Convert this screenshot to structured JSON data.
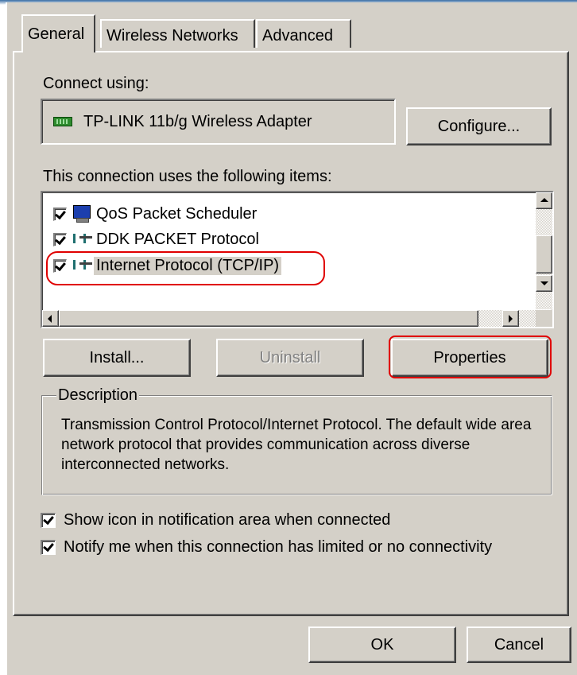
{
  "tabs": [
    {
      "label": "General",
      "active": true
    },
    {
      "label": "Wireless Networks",
      "active": false
    },
    {
      "label": "Advanced",
      "active": false
    }
  ],
  "connect_using": {
    "label": "Connect using:",
    "adapter_name": "TP-LINK 11b/g Wireless Adapter",
    "adapter_icon": "network-card-icon",
    "configure_label": "Configure..."
  },
  "items_section": {
    "label": "This connection uses the following items:",
    "items": [
      {
        "label": "QoS Packet Scheduler",
        "checked": true,
        "icon": "monitor-icon"
      },
      {
        "label": "DDK PACKET Protocol",
        "checked": true,
        "icon": "network-protocol-icon"
      },
      {
        "label": "Internet Protocol (TCP/IP)",
        "checked": true,
        "icon": "network-protocol-icon",
        "selected": true
      }
    ]
  },
  "buttons": {
    "install": "Install...",
    "uninstall": "Uninstall",
    "properties": "Properties",
    "ok": "OK",
    "cancel": "Cancel"
  },
  "description": {
    "title": "Description",
    "text": "Transmission Control Protocol/Internet Protocol. The default wide area network protocol that provides communication across diverse interconnected networks."
  },
  "options": [
    {
      "label": "Show icon in notification area when connected",
      "checked": true
    },
    {
      "label": "Notify me when this connection has limited or no connectivity",
      "checked": true
    }
  ],
  "colors": {
    "dialog_face": "#d4d0c8",
    "highlight_ring": "#e00000",
    "title_accent": "#3a6ea5"
  }
}
